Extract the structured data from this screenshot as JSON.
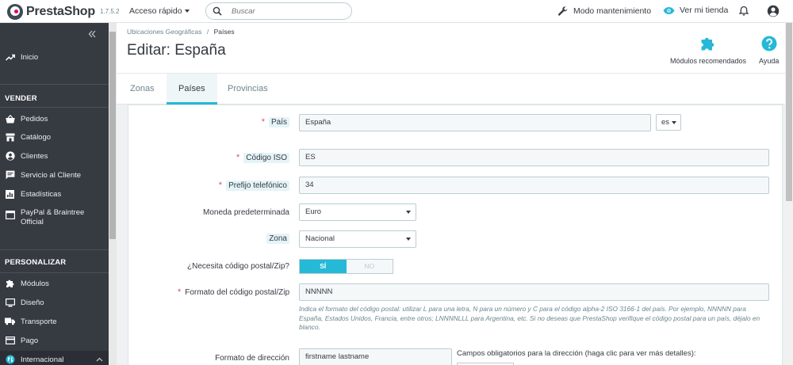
{
  "header": {
    "brand": "PrestaShop",
    "version": "1.7.5.2",
    "quick_access": "Acceso rápido",
    "search_placeholder": "Buscar",
    "maintenance": "Modo mantenimiento",
    "view_shop": "Ver mi tienda"
  },
  "sidebar": {
    "home": "Inicio",
    "sections": [
      {
        "title": "VENDER",
        "items": [
          "Pedidos",
          "Catálogo",
          "Clientes",
          "Servicio al Cliente",
          "Estadísticas",
          "PayPal & Braintree Official"
        ]
      },
      {
        "title": "PERSONALIZAR",
        "items": [
          "Módulos",
          "Diseño",
          "Transporte",
          "Pago",
          "Internacional"
        ]
      }
    ]
  },
  "page": {
    "breadcrumb": [
      "Ubicaciones Geográficas",
      "/",
      "Países"
    ],
    "title": "Editar: España",
    "toolbar": {
      "modules": "Módulos recomendados",
      "help": "Ayuda"
    },
    "tabs": [
      {
        "label": "Zonas",
        "active": false
      },
      {
        "label": "Países",
        "active": true
      },
      {
        "label": "Provincias",
        "active": false
      }
    ]
  },
  "form": {
    "country": {
      "required": "*",
      "label": "País",
      "value": "España",
      "lang": "es"
    },
    "iso": {
      "required": "*",
      "label": "Código ISO",
      "value": "ES"
    },
    "phone": {
      "required": "*",
      "label": "Prefijo telefónico",
      "value": "34"
    },
    "currency": {
      "label": "Moneda predeterminada",
      "value": "Euro"
    },
    "zone": {
      "label": "Zona",
      "value": "Nacional"
    },
    "zip_needed": {
      "label": "¿Necesita código postal/Zip?",
      "yes": "SÍ",
      "no": "NO",
      "value": "yes"
    },
    "zip_format": {
      "required": "*",
      "label": "Formato del código postal/Zip",
      "value": "NNNNN",
      "help": "Indica el formato del código postal: utilizar L para una letra, N para un número y C para el código alpha-2 ISO 3166-1 del país. Por ejemplo, NNNNN para España, Estados Unidos, Francia, entre otros; LNNNNLLL para Argentina, etc. Si no deseas que PrestaShop verifique el código postal para un país, déjalo en blanco."
    },
    "address_format": {
      "label": "Formato de dirección",
      "value": "firstname lastname",
      "required_fields_label": "Campos obligatorios para la dirección (haga clic para ver más detalles):"
    }
  },
  "colors": {
    "accent": "#25b9d7",
    "sidebar": "#363a41",
    "required": "#c05c67"
  }
}
